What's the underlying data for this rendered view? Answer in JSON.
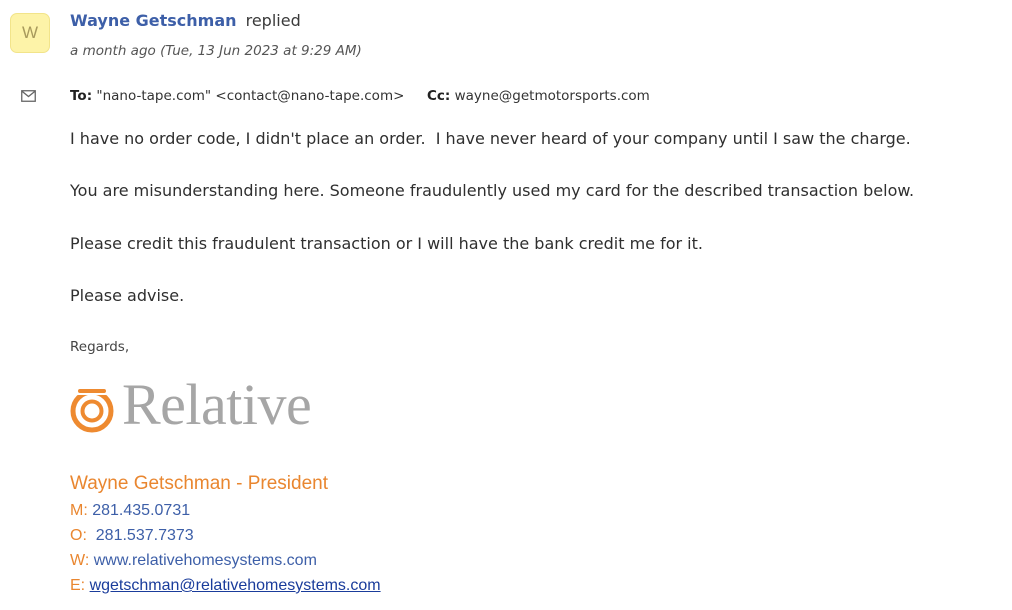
{
  "header": {
    "avatar_letter": "W",
    "sender_name": "Wayne Getschman",
    "action": "replied",
    "timestamp": "a month ago (Tue, 13 Jun 2023 at 9:29 AM)"
  },
  "recipients": {
    "to_label": "To:",
    "to_value": "\"nano-tape.com\" <contact@nano-tape.com>",
    "cc_label": "Cc:",
    "cc_value": "wayne@getmotorsports.com"
  },
  "body": {
    "paragraphs": [
      "I have no order code, I didn't place an order.  I have never heard of your company until I saw the charge.",
      "You are misunderstanding here. Someone fraudulently used my card for the described transaction below.",
      "Please credit this fraudulent transaction or I will have the bank credit me for it.",
      "Please advise."
    ],
    "regards": "Regards,"
  },
  "signature": {
    "logo_text": "Relative",
    "name_title": "Wayne Getschman - President",
    "mobile_label": "M:",
    "mobile_value": "281.435.0731",
    "office_label": "O:",
    "office_value": "281.537.7373",
    "web_label": "W:",
    "web_value": "www.relativehomesystems.com",
    "email_label": "E:",
    "email_value": "wgetschman@relativehomesystems.com"
  },
  "colors": {
    "sender_blue": "#3d5fa8",
    "signature_orange": "#e9862f",
    "avatar_yellow": "#fdf3a8",
    "logo_gray": "#a6a6a6"
  },
  "icons": {
    "message_type": "envelope-icon",
    "logo_mark": "power-ring-icon"
  }
}
